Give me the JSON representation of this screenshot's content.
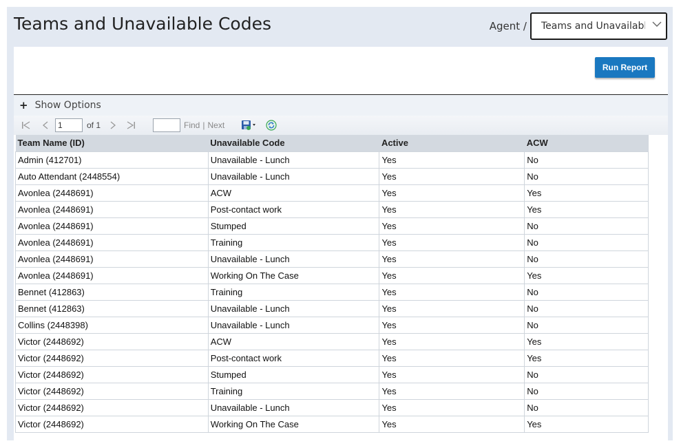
{
  "header": {
    "title": "Teams and Unavailable Codes",
    "breadcrumb": "Agent /",
    "report_select_value": "Teams and Unavailable Codes"
  },
  "actions": {
    "run_report_label": "Run Report"
  },
  "options": {
    "show_options_label": "Show Options"
  },
  "toolbar": {
    "page_value": "1",
    "page_of": "of 1",
    "find_label": "Find",
    "separator": "|",
    "next_label": "Next"
  },
  "table": {
    "headers": [
      "Team Name (ID)",
      "Unavailable Code",
      "Active",
      "ACW"
    ],
    "rows": [
      [
        "Admin (412701)",
        "Unavailable - Lunch",
        "Yes",
        "No"
      ],
      [
        "Auto Attendant (2448554)",
        "Unavailable - Lunch",
        "Yes",
        "No"
      ],
      [
        "Avonlea (2448691)",
        "ACW",
        "Yes",
        "Yes"
      ],
      [
        "Avonlea (2448691)",
        "Post-contact work",
        "Yes",
        "Yes"
      ],
      [
        "Avonlea (2448691)",
        "Stumped",
        "Yes",
        "No"
      ],
      [
        "Avonlea (2448691)",
        "Training",
        "Yes",
        "No"
      ],
      [
        "Avonlea (2448691)",
        "Unavailable - Lunch",
        "Yes",
        "No"
      ],
      [
        "Avonlea (2448691)",
        "Working On The Case",
        "Yes",
        "Yes"
      ],
      [
        "Bennet (412863)",
        "Training",
        "Yes",
        "No"
      ],
      [
        "Bennet (412863)",
        "Unavailable - Lunch",
        "Yes",
        "No"
      ],
      [
        "Collins (2448398)",
        "Unavailable - Lunch",
        "Yes",
        "No"
      ],
      [
        "Victor (2448692)",
        "ACW",
        "Yes",
        "Yes"
      ],
      [
        "Victor (2448692)",
        "Post-contact work",
        "Yes",
        "Yes"
      ],
      [
        "Victor (2448692)",
        "Stumped",
        "Yes",
        "No"
      ],
      [
        "Victor (2448692)",
        "Training",
        "Yes",
        "No"
      ],
      [
        "Victor (2448692)",
        "Unavailable - Lunch",
        "Yes",
        "No"
      ],
      [
        "Victor (2448692)",
        "Working On The Case",
        "Yes",
        "Yes"
      ]
    ]
  },
  "icons": {
    "first_page": "first-page-icon",
    "prev_page": "prev-page-icon",
    "next_page": "next-page-icon",
    "last_page": "last-page-icon",
    "export": "save-export-icon",
    "refresh": "refresh-icon",
    "dropdown": "chevron-down-icon",
    "expand": "plus-icon"
  },
  "colors": {
    "accent": "#1a78c0",
    "frame_bg": "#e3e9f2",
    "header_row_bg": "#d3d9e0",
    "refresh_green": "#3aa655"
  }
}
